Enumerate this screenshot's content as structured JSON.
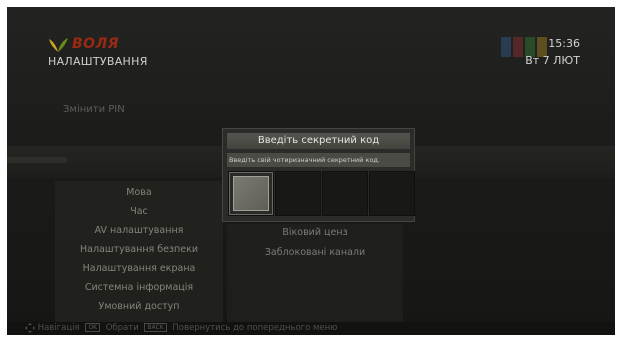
{
  "header": {
    "brand": "ВОЛЯ",
    "title": "НАЛАШТУВАННЯ",
    "time": "15:36",
    "date": "Вт 7 ЛЮТ"
  },
  "background": {
    "change_pin": "Змінити PIN"
  },
  "menu": {
    "items": [
      {
        "label": "Мова"
      },
      {
        "label": "Час"
      },
      {
        "label": "AV налаштування"
      },
      {
        "label": "Налаштування безпеки"
      },
      {
        "label": "Налаштування екрана"
      },
      {
        "label": "Системна інформація"
      },
      {
        "label": "Умовний доступ"
      }
    ],
    "selected_index": 3
  },
  "submenu": {
    "items": [
      {
        "label": "Віковий ценз"
      },
      {
        "label": "Заблоковані канали"
      }
    ]
  },
  "dialog": {
    "title": "Введіть секретний код",
    "message": "Введіть свій чотиризначний секретний код.",
    "digit_count": 4,
    "active_digit": 1
  },
  "footer": {
    "nav_label": "Навігація",
    "ok_key": "OK",
    "select_label": "Обрати",
    "back_key": "BACK",
    "back_label": "Повернутись до попереднього меню"
  },
  "colors": {
    "brand_red": "#9a2a13",
    "leaf_green": "#6a8a1e",
    "leaf_yellow": "#c9a521"
  }
}
